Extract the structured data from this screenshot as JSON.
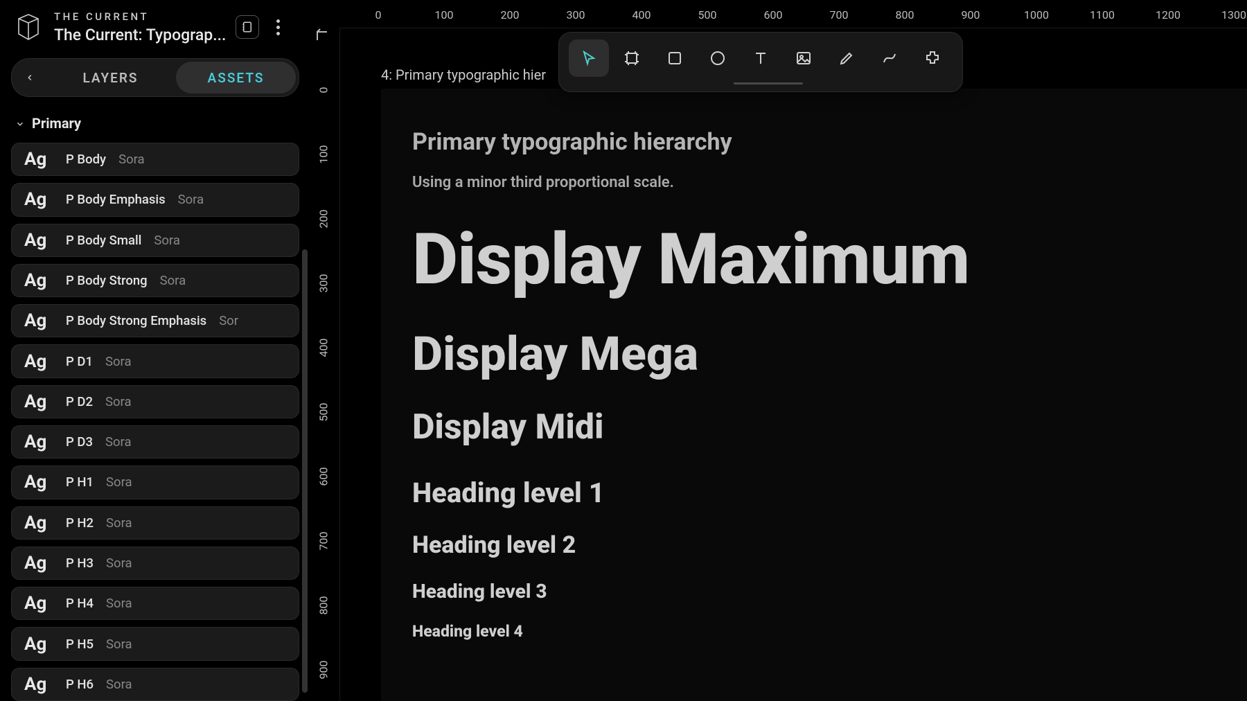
{
  "header": {
    "project": "THE CURRENT",
    "document": "The Current: Typograp..."
  },
  "sidebar": {
    "tabs": {
      "layers": "LAYERS",
      "assets": "ASSETS",
      "active": "assets"
    },
    "group": "Primary",
    "ag_glyph": "Ag",
    "items": [
      {
        "name": "P Body",
        "font": "Sora"
      },
      {
        "name": "P Body Emphasis",
        "font": "Sora"
      },
      {
        "name": "P Body Small",
        "font": "Sora"
      },
      {
        "name": "P Body Strong",
        "font": "Sora"
      },
      {
        "name": "P Body Strong Emphasis",
        "font": "Sor"
      },
      {
        "name": "P D1",
        "font": "Sora"
      },
      {
        "name": "P D2",
        "font": "Sora"
      },
      {
        "name": "P D3",
        "font": "Sora"
      },
      {
        "name": "P H1",
        "font": "Sora"
      },
      {
        "name": "P H2",
        "font": "Sora"
      },
      {
        "name": "P H3",
        "font": "Sora"
      },
      {
        "name": "P H4",
        "font": "Sora"
      },
      {
        "name": "P H5",
        "font": "Sora"
      },
      {
        "name": "P H6",
        "font": "Sora"
      }
    ]
  },
  "ruler": {
    "h": [
      "0",
      "100",
      "200",
      "300",
      "400",
      "500",
      "600",
      "700",
      "800",
      "900",
      "1000",
      "1100",
      "1200",
      "1300"
    ],
    "v": [
      "0",
      "100",
      "200",
      "300",
      "400",
      "500",
      "600",
      "700",
      "800",
      "900"
    ]
  },
  "canvas": {
    "artboard_label": "4: Primary typographic hier",
    "title": "Primary typographic hierarchy",
    "subtitle": "Using a minor third proportional scale.",
    "samples": {
      "display_max": "Display Maximum",
      "display_mega": "Display Mega",
      "display_midi": "Display Midi",
      "h1": "Heading level 1",
      "h2": "Heading level 2",
      "h3": "Heading level 3",
      "h4": "Heading level 4"
    }
  },
  "toolbar": {
    "tools": [
      "pointer",
      "frame",
      "rectangle",
      "ellipse",
      "text",
      "image",
      "pencil",
      "curve",
      "plugin"
    ],
    "active": "pointer"
  },
  "colors": {
    "accent": "#4cc9d8",
    "bg": "#000000",
    "panel": "#1b1b1b"
  }
}
